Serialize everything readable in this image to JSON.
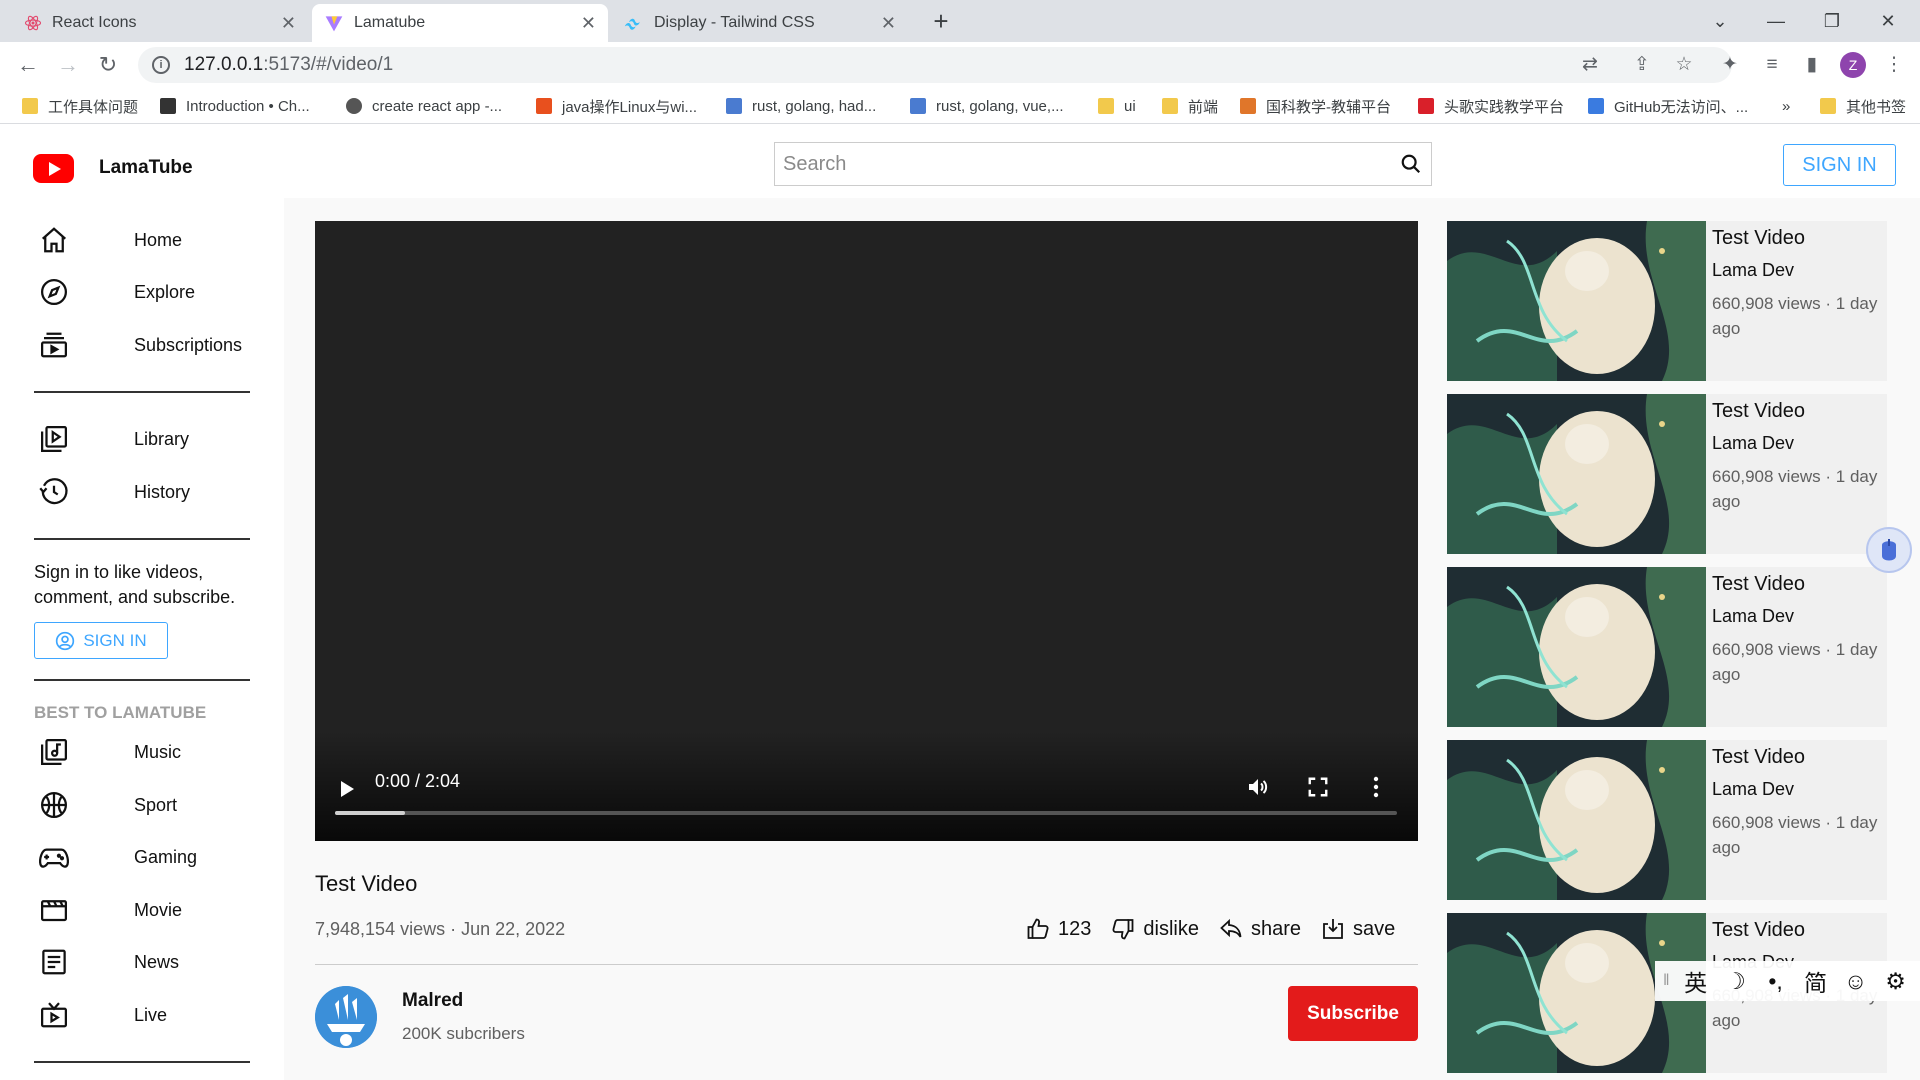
{
  "browser": {
    "tabs": [
      {
        "title": "React Icons",
        "active": false
      },
      {
        "title": "Lamatube",
        "active": true
      },
      {
        "title": "Display - Tailwind CSS",
        "active": false
      }
    ],
    "url_host": "127.0.0.1",
    "url_rest": ":5173/#/video/1",
    "profile_initial": "Z",
    "bookmarks": [
      {
        "label": "工作具体问题",
        "icon_color": "#f2c94c"
      },
      {
        "label": "Introduction • Ch...",
        "icon_color": "#333333"
      },
      {
        "label": "create react app -...",
        "icon_color": "#555555"
      },
      {
        "label": "java操作Linux与wi...",
        "icon_color": "#e8501e"
      },
      {
        "label": "rust, golang, had...",
        "icon_color": "#4a7bd0"
      },
      {
        "label": "rust, golang, vue,...",
        "icon_color": "#4a7bd0"
      },
      {
        "label": "ui",
        "icon_color": "#f2c94c"
      },
      {
        "label": "前端",
        "icon_color": "#f2c94c"
      },
      {
        "label": "国科教学-教辅平台",
        "icon_color": "#e0762a"
      },
      {
        "label": "头歌实践教学平台",
        "icon_color": "#d9202a"
      },
      {
        "label": "GitHub无法访问、...",
        "icon_color": "#3a7be0"
      },
      {
        "label": "»",
        "icon_color": ""
      },
      {
        "label": "其他书签",
        "icon_color": "#f2c94c"
      }
    ]
  },
  "header": {
    "app_name": "LamaTube",
    "search_placeholder": "Search",
    "sign_in": "SIGN IN"
  },
  "sidebar": {
    "items": [
      {
        "label": "Home",
        "icon": "home-icon"
      },
      {
        "label": "Explore",
        "icon": "explore-icon"
      },
      {
        "label": "Subscriptions",
        "icon": "subscriptions-icon"
      },
      {
        "label": "Library",
        "icon": "library-icon"
      },
      {
        "label": "History",
        "icon": "history-icon"
      },
      {
        "label": "Music",
        "icon": "music-icon"
      },
      {
        "label": "Sport",
        "icon": "sport-icon"
      },
      {
        "label": "Gaming",
        "icon": "gaming-icon"
      },
      {
        "label": "Movie",
        "icon": "movie-icon"
      },
      {
        "label": "News",
        "icon": "news-icon"
      },
      {
        "label": "Live",
        "icon": "live-icon"
      }
    ],
    "sign_in_prompt": "Sign in to like videos, comment, and subscribe.",
    "sign_in": "SIGN IN",
    "section_heading": "BEST TO LAMATUBE"
  },
  "video": {
    "time": "0:00 / 2:04",
    "title": "Test Video",
    "meta": "7,948,154 views · Jun 22, 2022",
    "likes": "123",
    "dislike": "dislike",
    "share": "share",
    "save": "save"
  },
  "channel": {
    "name": "Malred",
    "subscribers": "200K subcribers",
    "subscribe": "Subscribe"
  },
  "recommendations": [
    {
      "title": "Test Video",
      "channel": "Lama Dev",
      "meta": "660,908 views · 1 day ago"
    },
    {
      "title": "Test Video",
      "channel": "Lama Dev",
      "meta": "660,908 views · 1 day ago"
    },
    {
      "title": "Test Video",
      "channel": "Lama Dev",
      "meta": "660,908 views · 1 day ago"
    },
    {
      "title": "Test Video",
      "channel": "Lama Dev",
      "meta": "660,908 views · 1 day ago"
    },
    {
      "title": "Test Video",
      "channel": "Lama Dev",
      "meta": "660,908 views · 1 day ago"
    }
  ],
  "ime_toolbar": [
    "英",
    "☽",
    "•,",
    "简",
    "☺",
    "⚙"
  ],
  "colors": {
    "brand_red": "#ff0000",
    "accent_blue": "#3ea6ff",
    "subscribe_red": "#e31b1b"
  }
}
